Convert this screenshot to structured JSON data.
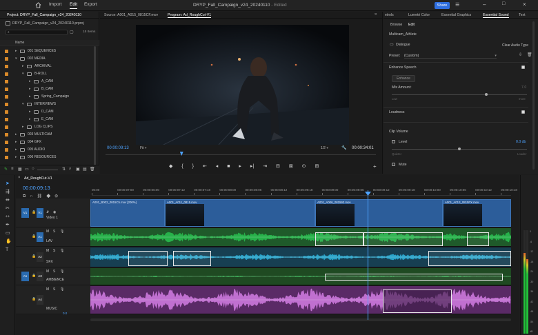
{
  "titlebar": {
    "tabs": [
      "Import",
      "Edit",
      "Export"
    ],
    "active_tab": "Edit",
    "document_title": "DRYP_Fall_Campaign_v24_20240110",
    "status": "- Edited",
    "share_label": "Share"
  },
  "project": {
    "tab_label": "Project: DRYP_Fall_Campaign_v24_20240110",
    "file_name": "DRYP_Fall_Campaign_v24_20240110.prproj",
    "item_count": "15 Items",
    "name_header": "Name",
    "bins": [
      {
        "label": "001 SEQUENCES",
        "level": 0,
        "expanded": false
      },
      {
        "label": "002 MEDIA",
        "level": 0,
        "expanded": true
      },
      {
        "label": "ARCHIVAL",
        "level": 1,
        "expanded": false
      },
      {
        "label": "B-ROLL",
        "level": 1,
        "expanded": true
      },
      {
        "label": "A_CAM",
        "level": 2,
        "expanded": false
      },
      {
        "label": "B_CAM",
        "level": 2,
        "expanded": false
      },
      {
        "label": "Spring_Campaign",
        "level": 2,
        "expanded": false
      },
      {
        "label": "INTERVIEWS",
        "level": 1,
        "expanded": true
      },
      {
        "label": "D_CAM",
        "level": 2,
        "expanded": false
      },
      {
        "label": "E_CAM",
        "level": 2,
        "expanded": false
      },
      {
        "label": "LOG CLIPS",
        "level": 1,
        "expanded": false
      },
      {
        "label": "003 MULTICAM",
        "level": 0,
        "expanded": false
      },
      {
        "label": "004 GFX",
        "level": 0,
        "expanded": false
      },
      {
        "label": "005 AUDIO",
        "level": 0,
        "expanded": false
      },
      {
        "label": "006 RESOURCES",
        "level": 0,
        "expanded": false
      }
    ]
  },
  "monitor": {
    "source_tab": "Source: A001_A015_0815CF.mov",
    "program_tab": "Program: Ad_RoughCut-V1",
    "timecode_current": "00:00:09:13",
    "fit_label": "Fit",
    "resolution_label": "1/2",
    "timecode_duration": "00:00:34:01",
    "playhead_fraction": 0.28
  },
  "sound": {
    "tabs": [
      "etrols",
      "Lumetri Color",
      "Essential Graphics",
      "Essential Sound",
      "Text"
    ],
    "active_tab": "Essential Sound",
    "subtabs": [
      "Browse",
      "Edit"
    ],
    "active_subtab": "Edit",
    "clip_name": "Multicam_Athlete",
    "audio_type": "Dialogue",
    "clear_label": "Clear Audio Type",
    "preset_label": "Preset:",
    "preset_value": "(Custom)",
    "enhance_speech_label": "Enhance Speech",
    "enhance_button": "Enhance",
    "mix_amount_label": "Mix Amount:",
    "mix_amount_value": "7.0",
    "mix_low": "Low",
    "mix_high": "more",
    "mix_fraction": 0.7,
    "loudness_label": "Loudness",
    "clip_volume_label": "Clip Volume",
    "level_label": "Level",
    "level_value": "0.0 db",
    "level_fraction": 0.5,
    "level_low": "Quieter",
    "level_high": "Louder",
    "mute_label": "Mute"
  },
  "timeline": {
    "tab_label": "Ad_RoughCut-V1",
    "timecode": "00:00:09:13",
    "ruler": [
      "00:00",
      "00:00:07:00",
      "00:00:06:00",
      "00:00:07:12",
      "00:00:07:18",
      "00:00:08:00",
      "00:00:08:06",
      "00:00:08:12",
      "00:00:09:18",
      "00:00:09:00",
      "00:00:09:06",
      "00:00:09:12",
      "00:00:09:18",
      "00:00:10:00",
      "00:00:10:06",
      "00:00:10:12",
      "00:00:10:18"
    ],
    "tracks": {
      "v1": {
        "patch": "V1",
        "label": "V1",
        "name": "Video 1"
      },
      "a1": {
        "label": "A1",
        "name": "LAV"
      },
      "a2": {
        "label": "A2",
        "name": "SFX"
      },
      "a3": {
        "patch": "A1",
        "label": "A3",
        "name": "AMBIENCE"
      },
      "a4": {
        "label": "A4",
        "name": "MUSIC",
        "volume": "0.0"
      }
    },
    "video_clips": [
      {
        "name": "A001_B002_0815C5.mov [200%]"
      },
      {
        "name": "A001_A011_0815.mov"
      },
      {
        "name": "A001_A006_081593.mov"
      },
      {
        "name": "A001_A013_0815FX.mov"
      }
    ],
    "colors": {
      "lav": "#27b14a",
      "sfx": "#2aa3c9",
      "music": "#c070d0",
      "video": "#2c5d9a",
      "playhead": "#4ea3ff"
    }
  },
  "meters": {
    "scale": [
      "0",
      "-6",
      "-12",
      "-18",
      "-24",
      "-30",
      "-36",
      "-42",
      "-48",
      "-54",
      "dB"
    ],
    "left_level": 0.78,
    "right_level": 0.72
  }
}
